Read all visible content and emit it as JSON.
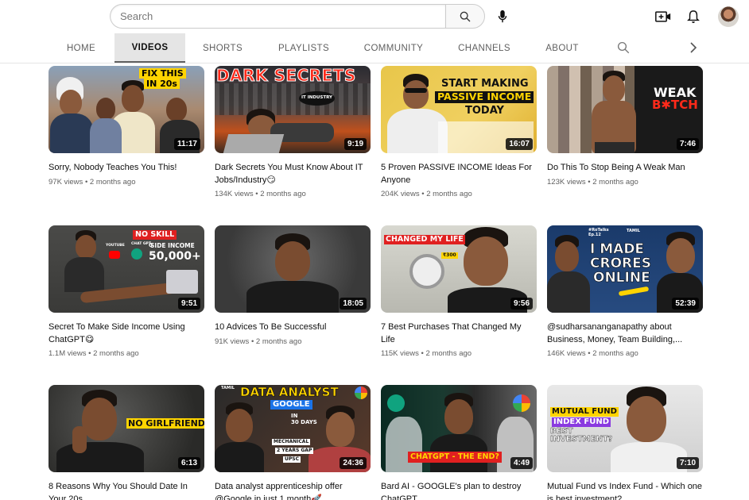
{
  "search": {
    "placeholder": "Search"
  },
  "tabs": [
    {
      "label": "HOME"
    },
    {
      "label": "VIDEOS"
    },
    {
      "label": "SHORTS"
    },
    {
      "label": "PLAYLISTS"
    },
    {
      "label": "COMMUNITY"
    },
    {
      "label": "CHANNELS"
    },
    {
      "label": "ABOUT"
    }
  ],
  "videos": [
    {
      "title": "Sorry, Nobody Teaches You This!",
      "views": "97K views",
      "age": "2 months ago",
      "duration": "11:17",
      "thumb_text": [
        "FIX THIS",
        "IN 20s"
      ]
    },
    {
      "title": "Dark Secrets You Must Know About IT Jobs/Industry😏",
      "views": "134K views",
      "age": "2 months ago",
      "duration": "9:19",
      "thumb_text": [
        "DARK SECRETS",
        "IT INDUSTRY"
      ]
    },
    {
      "title": "5 Proven PASSIVE INCOME Ideas For Anyone",
      "views": "204K views",
      "age": "2 months ago",
      "duration": "16:07",
      "thumb_text": [
        "START MAKING",
        "PASSIVE INCOME",
        "TODAY"
      ]
    },
    {
      "title": "Do This To Stop Being A Weak Man",
      "views": "123K views",
      "age": "2 months ago",
      "duration": "7:46",
      "thumb_text": [
        "WEAK",
        "B✱TCH"
      ]
    },
    {
      "title": "Secret To Make Side Income Using ChatGPT😋",
      "views": "1.1M views",
      "age": "2 months ago",
      "duration": "9:51",
      "thumb_text": [
        "NO SKILL",
        "SIDE INCOME",
        "50,000+",
        "YOUTUBE",
        "CHAT GPT"
      ]
    },
    {
      "title": "10 Advices To Be Successful",
      "views": "91K views",
      "age": "2 months ago",
      "duration": "18:05",
      "thumb_text": []
    },
    {
      "title": "7 Best Purchases That Changed My Life",
      "views": "115K views",
      "age": "2 months ago",
      "duration": "9:56",
      "thumb_text": [
        "CHANGED MY LIFE",
        "₹300"
      ]
    },
    {
      "title": "@sudharsananganapathy about Business, Money, Team Building,...",
      "views": "146K views",
      "age": "2 months ago",
      "duration": "52:39",
      "thumb_text": [
        "I MADE",
        "CRORES",
        "ONLINE",
        "#RoTalks",
        "Ep.12",
        "TAMIL"
      ]
    },
    {
      "title": "8 Reasons Why You Should Date In Your 20s",
      "views": "",
      "age": "",
      "duration": "6:13",
      "thumb_text": [
        "NO GIRLFRIEND"
      ]
    },
    {
      "title": "Data analyst apprenticeship offer @Google in just 1 month🚀",
      "views": "",
      "age": "",
      "duration": "24:36",
      "thumb_text": [
        "DATA ANALYST",
        "GOOGLE",
        "IN",
        "30 DAYS",
        "MECHANICAL",
        "2 YEARS GAP",
        "UPSC",
        "TAMIL"
      ]
    },
    {
      "title": "Bard AI - GOOGLE's plan to destroy ChatGPT",
      "views": "",
      "age": "",
      "duration": "4:49",
      "thumb_text": [
        "CHATGPT - THE END?"
      ]
    },
    {
      "title": "Mutual Fund vs Index Fund - Which one is best investment?",
      "views": "",
      "age": "",
      "duration": "7:10",
      "thumb_text": [
        "MUTUAL FUND",
        "INDEX FUND",
        "BEST",
        "INVESTMENT?"
      ]
    }
  ],
  "meta_separator": "•",
  "colors": {
    "accent_red": "#ff0000",
    "yellow": "#ffd400",
    "text_secondary": "#606060"
  },
  "icons": [
    "search-icon",
    "mic-icon",
    "create-video-icon",
    "bell-icon",
    "avatar",
    "tab-search-icon",
    "chevron-right-icon"
  ]
}
